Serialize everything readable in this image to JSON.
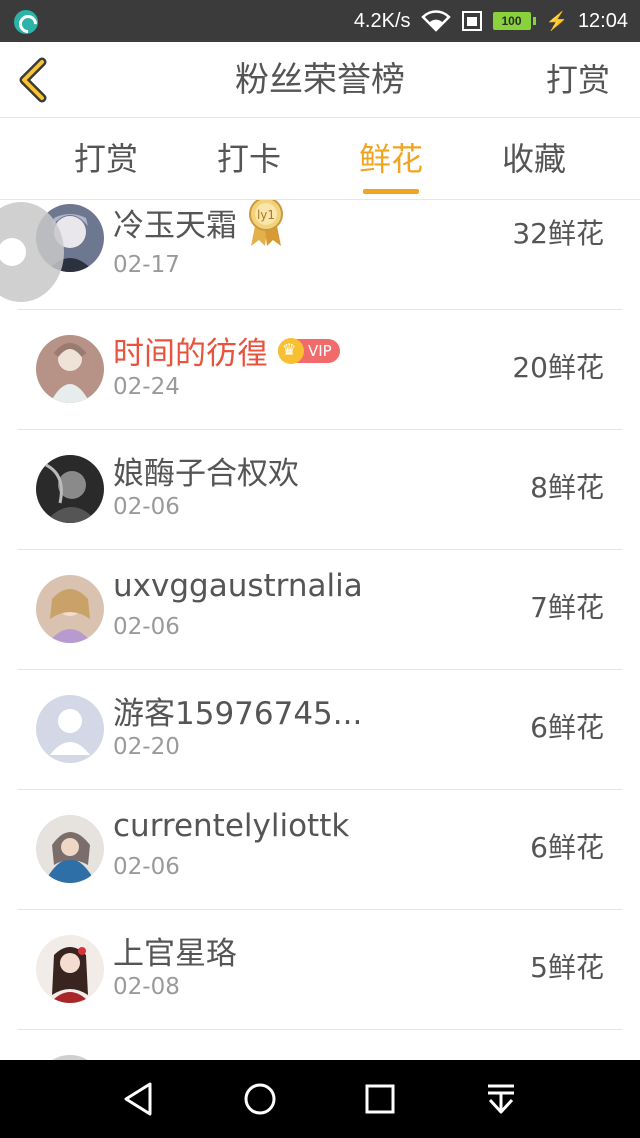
{
  "status_bar": {
    "speed": "4.2K/s",
    "battery": "100",
    "time": "12:04"
  },
  "header": {
    "title": "粉丝荣誉榜",
    "action": "打赏"
  },
  "tabs": [
    {
      "label": "打赏"
    },
    {
      "label": "打卡"
    },
    {
      "label": "鲜花",
      "active": true
    },
    {
      "label": "收藏"
    }
  ],
  "rows": [
    {
      "name": "冷玉天霜",
      "badge": "ly1",
      "date": "02-17",
      "count": "32鲜花"
    },
    {
      "name": "时间的彷徨",
      "badge_vip": "VIP",
      "date": "02-24",
      "count": "20鲜花"
    },
    {
      "name": "娘酶子合权欢",
      "date": "02-06",
      "count": "8鲜花"
    },
    {
      "name": "uxvggaustrnalia",
      "date": "02-06",
      "count": "7鲜花"
    },
    {
      "name": "游客15976745...",
      "date": "02-20",
      "count": "6鲜花"
    },
    {
      "name": "currentelyliottk",
      "date": "02-06",
      "count": "6鲜花"
    },
    {
      "name": "上官星珞",
      "date": "02-08",
      "count": "5鲜花"
    }
  ],
  "colors": {
    "accent": "#f0a521",
    "highlight_name": "#e9533d"
  }
}
